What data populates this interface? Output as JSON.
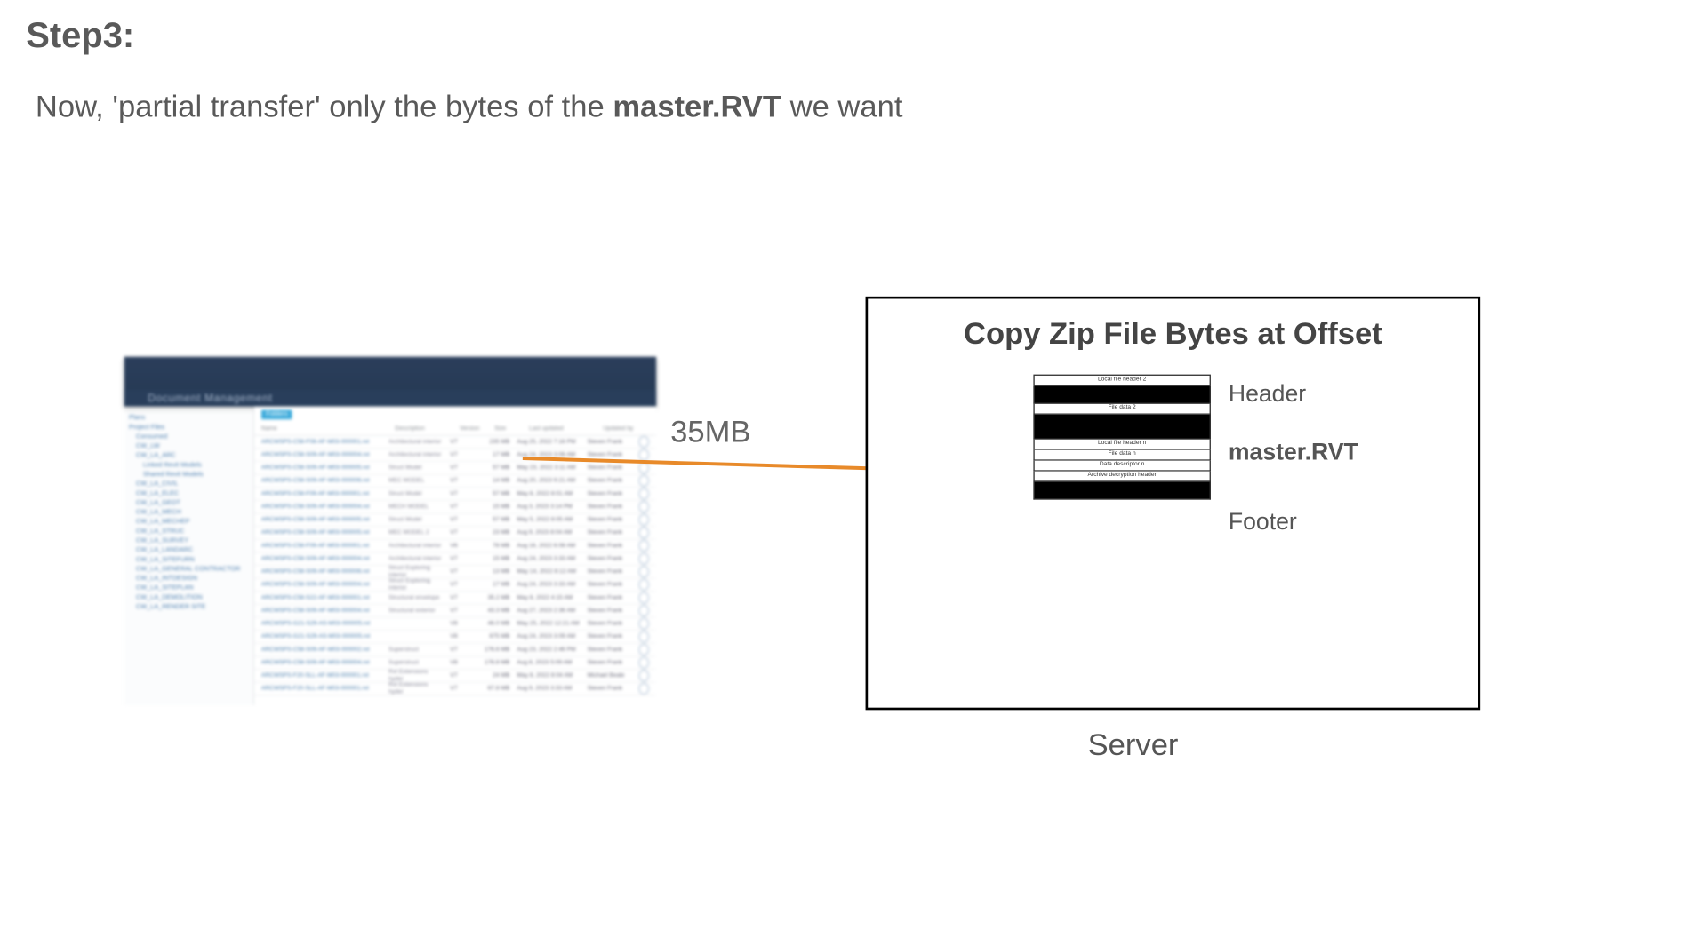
{
  "step": {
    "title": "Step3:"
  },
  "subtitle": {
    "prefix": "Now, 'partial transfer' only the bytes of the ",
    "bold": "master.RVT",
    "suffix": " we want"
  },
  "transfer": {
    "size_label": "35MB"
  },
  "server": {
    "box_title": "Copy Zip File Bytes at Offset",
    "caption": "Server",
    "labels": {
      "header": "Header",
      "file": "master.RVT",
      "footer": "Footer"
    },
    "zip_rows": {
      "lh2": "Local file header 2",
      "fd2": "File data 2",
      "lhn": "Local file header n",
      "fdn": "File data n",
      "ddn": "Data descriptor n",
      "adh": "Archive decryption header"
    }
  },
  "app": {
    "title": "Document Management",
    "tabs": {
      "folders": "Folders",
      "other": ""
    },
    "columns": {
      "name": "Name",
      "description": "Description",
      "version": "Version",
      "size": "Size",
      "last_updated": "Last updated",
      "updated_by": "Updated by"
    },
    "tree": [
      "Plans",
      "Project Files",
      "  Consumed",
      "  CW_LW",
      "  CW_LA_ARC",
      "    Linked Revit Models",
      "    Shared Revit Models",
      "  CW_LA_CIVIL",
      "  CW_LA_ELEC",
      "  CW_LA_GEOT",
      "  CW_LA_MECH",
      "  CW_LA_MECHEP",
      "  CW_LA_STRUC",
      "  CW_LA_SURVEY",
      "  CW_LA_LANDARC",
      "  CW_LA_SITEFURN",
      "  CW_LA_GENERAL CONTRACTOR",
      "  CW_LA_INTDESIGN",
      "  CW_LA_SITEPLAN",
      "  CW_LA_DEMOLITION",
      "  CW_LA_RENDER SITE"
    ],
    "rows": [
      {
        "name": "ARCWSPS-C58-F08-AF-M03-000001.rvt",
        "desc": "Architectural interior",
        "ver": "V7",
        "size": "235 MB",
        "updated": "Aug 25, 2022 7:16 PM",
        "by": "Steven Frank"
      },
      {
        "name": "ARCWSPS-C58-S09-AF-M03-000004.rvt",
        "desc": "Architectural interior",
        "ver": "V7",
        "size": "17 MB",
        "updated": "Aug 24, 2023 3:06 AM",
        "by": "Steven Frank"
      },
      {
        "name": "ARCWSPS-C58-S09-AF-M03-000005.rvt",
        "desc": "Struct Model",
        "ver": "V7",
        "size": "57 MB",
        "updated": "May 23, 2022 3:11 AM",
        "by": "Steven Frank"
      },
      {
        "name": "ARCWSPS-C58-S09-AF-M03-000006.rvt",
        "desc": "MEC MODEL",
        "ver": "V7",
        "size": "14 MB",
        "updated": "Aug 20, 2023 9:21 AM",
        "by": "Steven Frank"
      },
      {
        "name": "ARCWSPS-C58-F09-AF-M03-000001.rvt",
        "desc": "Struct Model",
        "ver": "V7",
        "size": "57 MB",
        "updated": "May 8, 2022 8:01 AM",
        "by": "Steven Frank"
      },
      {
        "name": "ARCWSPS-C58-S09-AF-M03-000004.rvt",
        "desc": "MECH MODEL",
        "ver": "V7",
        "size": "15 MB",
        "updated": "Aug 3, 2023 3:14 PM",
        "by": "Steven Frank"
      },
      {
        "name": "ARCWSPS-C58-S09-AF-M03-000005.rvt",
        "desc": "Struct Model",
        "ver": "V7",
        "size": "57 MB",
        "updated": "May 5, 2022 8:05 AM",
        "by": "Steven Frank"
      },
      {
        "name": "ARCWSPS-C58-S09-AF-M03-000005.rvt",
        "desc": "MEC MODEL 2",
        "ver": "V7",
        "size": "23 MB",
        "updated": "Aug 9, 2023 8:04 AM",
        "by": "Steven Frank"
      },
      {
        "name": "ARCWSPS-C58-F09-AF-M03-000001.rvt",
        "desc": "Architectural interior",
        "ver": "V6",
        "size": "78 MB",
        "updated": "Aug 16, 2022 6:08 AM",
        "by": "Steven Frank"
      },
      {
        "name": "ARCWSPS-C58-S09-AF-M03-000004.rvt",
        "desc": "Architectural interior",
        "ver": "V7",
        "size": "15 MB",
        "updated": "Aug 24, 2023 3:33 AM",
        "by": "Steven Frank"
      },
      {
        "name": "ARCWSPS-C58-S09-AF-M03-000006.rvt",
        "desc": "Struct Exploring interior",
        "ver": "V7",
        "size": "13 MB",
        "updated": "May 14, 2022 8:12 AM",
        "by": "Steven Frank"
      },
      {
        "name": "ARCWSPS-C58-S09-AF-M03-000004.rvt",
        "desc": "Struct Exploring interior",
        "ver": "V7",
        "size": "17 MB",
        "updated": "Aug 24, 2023 3:33 AM",
        "by": "Steven Frank"
      },
      {
        "name": "ARCWSPS-C58-S22-AF-M03-000001.rvt",
        "desc": "Structural envelope",
        "ver": "V7",
        "size": "35.2 MB",
        "updated": "May 8, 2022 4:15 AM",
        "by": "Steven Frank"
      },
      {
        "name": "ARCWSPS-C58-S09-AF-M03-000004.rvt",
        "desc": "Structural exterior",
        "ver": "V7",
        "size": "43.3 MB",
        "updated": "Aug 27, 2023 2:36 AM",
        "by": "Steven Frank"
      },
      {
        "name": "ARCWSPS-G21-S29-AS-M03-000005.rvt",
        "desc": "",
        "ver": "V8",
        "size": "46.0 MB",
        "updated": "May 25, 2022 12:21 AM",
        "by": "Steven Frank"
      },
      {
        "name": "ARCWSPS-G21-S29-AS-M03-000005.rvt",
        "desc": "",
        "ver": "V8",
        "size": "675 MB",
        "updated": "Aug 24, 2023 3:09 AM",
        "by": "Steven Frank"
      },
      {
        "name": "ARCWSPS-C58-S09-AF-M03-000002.rvt",
        "desc": "Superstruct",
        "ver": "V7",
        "size": "176.6 MB",
        "updated": "Aug 23, 2022 2:46 PM",
        "by": "Steven Frank"
      },
      {
        "name": "ARCWSPS-C58-S09-AF-M03-000004.rvt",
        "desc": "Superstruct",
        "ver": "V8",
        "size": "178.8 MB",
        "updated": "Aug 8, 2023 5:09 AM",
        "by": "Steven Frank"
      },
      {
        "name": "ARCWSPS-F20-SLL-AF-M03-000001.rvt",
        "desc": "Rvt Extensions hyder",
        "ver": "V7",
        "size": "24 MB",
        "updated": "May 8, 2022 8:04 AM",
        "by": "Michael Beale"
      },
      {
        "name": "ARCWSPS-F20-SLL-AF-M03-000001.rvt",
        "desc": "Rvt Extensions hyder",
        "ver": "V7",
        "size": "67.8 MB",
        "updated": "Aug 9, 2023 3:33 AM",
        "by": "Steven Frank"
      }
    ]
  }
}
